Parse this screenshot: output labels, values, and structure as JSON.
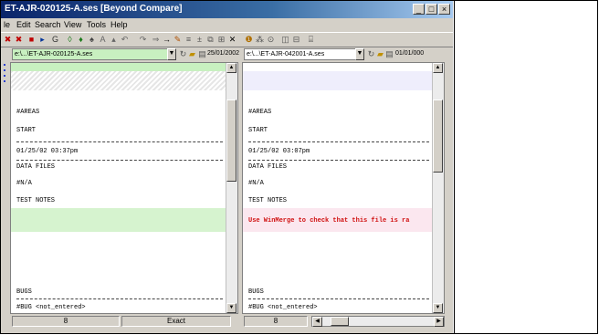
{
  "window": {
    "title": "ET-AJR-020125-A.ses [Beyond Compare]"
  },
  "window_controls": {
    "minimize": "_",
    "maximize": "□",
    "close": "×"
  },
  "menu": [
    {
      "label": "le"
    },
    {
      "label": "Edit"
    },
    {
      "label": "Search"
    },
    {
      "label": "View"
    },
    {
      "label": "Tools"
    },
    {
      "label": "Help"
    }
  ],
  "toolbar": {
    "icons": [
      "red-x-icon",
      "red-x-icon",
      "back-icon",
      "forward-icon",
      "refresh-icon",
      "up-icon",
      "down-icon",
      "binoculars-icon",
      "text-icon",
      "filter-icon",
      "undo-icon",
      "redo-icon",
      "next-diff-icon",
      "edit-icon",
      "swap-icon",
      "copy-icon",
      "paste-icon",
      "delete-icon",
      "help-icon",
      "settings-icon",
      "rules-icon",
      "window-icon",
      "compare-icon",
      "link-icon",
      "view-icon",
      "save-icon"
    ]
  },
  "left": {
    "path": "e:\\...\\ET-AJR-020125-A.ses",
    "date": "25/01/2002",
    "lines": [
      "#AREAS",
      "START",
      "01/25/02 03:37pm",
      "DATA FILES",
      "#N/A",
      "TEST NOTES",
      "BUGS",
      "#BUG <not_entered>"
    ]
  },
  "right": {
    "path": "e:\\...\\ET-AJR-042001-A.ses",
    "date": "01/01/000",
    "lines": [
      "#AREAS",
      "START",
      "01/25/02 03:07pm",
      "DATA FILES",
      "#N/A",
      "TEST NOTES",
      "BUGS",
      "#BUG <not_entered>"
    ],
    "highlight": "Use WinMerge to check that this file is ra"
  },
  "status": {
    "left_count": "8",
    "left_mode": "Exact",
    "right_count": "8"
  }
}
